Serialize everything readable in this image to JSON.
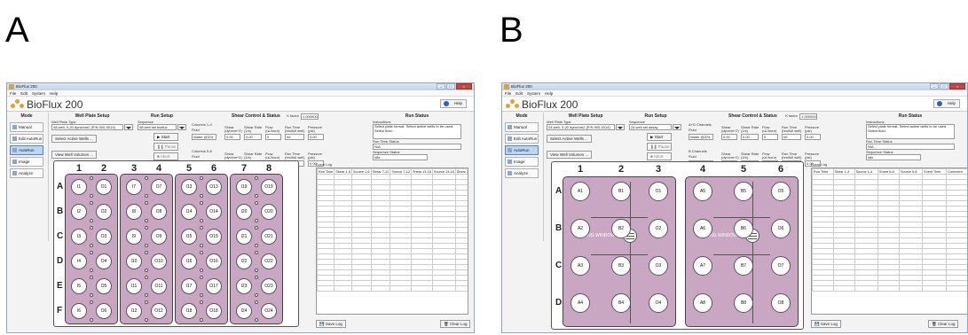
{
  "panels": [
    {
      "letter": "A",
      "window_title": "BioFlux 200",
      "menu": [
        "File",
        "Edit",
        "System",
        "Help"
      ],
      "app_name": "BioFlux 200",
      "help_label": "Help",
      "mode": {
        "heading": "Mode",
        "buttons": [
          "Manual",
          "Edit AutoRun",
          "AutoRun",
          "Image",
          "Analyze"
        ],
        "active": "AutoRun"
      },
      "well_plate_setup": {
        "heading": "Well Plate Setup",
        "type_label": "Well Plate Type",
        "type_value": "48-well, 0-20 dyne/cm2 (P/N 900-0013)",
        "select_active_wells": "Select Active Wells ...",
        "view_well_volumes": "View Well Volumes ..."
      },
      "run_setup": {
        "heading": "Run Setup",
        "sequence_label": "Sequence",
        "sequence_value": "48 well std bioflux",
        "start": "Start",
        "pause": "Pause",
        "abort": "Abort"
      },
      "shear": {
        "heading": "Shear Control & Status",
        "k_factor_label": "K factor",
        "k_factor_value": "1.000000",
        "groups": [
          {
            "name": "Columns 1-4",
            "fluid_label": "Fluid",
            "fluid": "Water @37d",
            "shear_label": "Shear (dyn/cm^2)",
            "shear": "0.00",
            "rate_label": "Shear Rate (1/s)",
            "rate": "0.00",
            "flow_label": "Flow (uL/hour)",
            "flow": "0",
            "runtime_label": "Run Time (hrs/full well)",
            "runtime": "Inf",
            "pressure_label": "Pressure (psi)",
            "pressure": "0.00"
          },
          {
            "name": "Columns 5-8",
            "fluid_label": "Fluid",
            "fluid": "Water @37d",
            "shear_label": "Shear (dyn/cm^2)",
            "shear": "0.00",
            "rate_label": "Shear Rate (1/s)",
            "rate": "0.00",
            "flow_label": "Flow (uL/hour)",
            "flow": "0",
            "runtime_label": "Run Time (hrs/full well)",
            "runtime": "Inf",
            "pressure_label": "Pressure (psi)",
            "pressure": "0.00"
          }
        ]
      },
      "run_status": {
        "heading": "Run Status",
        "instructions_label": "Instructions",
        "instructions": "Select plate format. Select active wells to be used. Select fluid.",
        "run_time_status_label": "Run Time Status",
        "run_time_status": "N/A",
        "sequence_status_label": "Sequence Status",
        "sequence_status": "Idle"
      },
      "plate": {
        "columns": [
          "1",
          "2",
          "3",
          "4",
          "5",
          "6",
          "7",
          "8"
        ],
        "rows": [
          "A",
          "B",
          "C",
          "D",
          "E",
          "F"
        ],
        "wells": [
          [
            "I1",
            "O1",
            "I7",
            "O7",
            "I13",
            "O13",
            "I19",
            "O19"
          ],
          [
            "I2",
            "O2",
            "I8",
            "O8",
            "I14",
            "O14",
            "I20",
            "O20"
          ],
          [
            "I3",
            "O3",
            "I9",
            "O9",
            "I15",
            "O15",
            "I21",
            "O21"
          ],
          [
            "I4",
            "O4",
            "I10",
            "O10",
            "I16",
            "O16",
            "I22",
            "O22"
          ],
          [
            "I5",
            "O5",
            "I11",
            "O11",
            "I17",
            "O17",
            "I23",
            "O23"
          ],
          [
            "I6",
            "O6",
            "I12",
            "O12",
            "I18",
            "O18",
            "I24",
            "O24"
          ]
        ]
      },
      "event_log": {
        "label": "Event Log",
        "columns": [
          "Run Time",
          "Shear 1-6",
          "Source 1-6",
          "Shear 7-12",
          "Source 7-12",
          "Shear 13-18",
          "Source 13-18",
          "Shear 19-24",
          "Sou 19-2"
        ],
        "save": "Save Log",
        "clear": "Clear Log"
      }
    },
    {
      "letter": "B",
      "window_title": "BioFlux 200",
      "menu": [
        "File",
        "Edit",
        "System",
        "Help"
      ],
      "app_name": "BioFlux 200",
      "help_label": "Help",
      "mode": {
        "heading": "Mode",
        "buttons": [
          "Manual",
          "Edit AutoRun",
          "AutoRun",
          "Image",
          "Analyze"
        ],
        "active": "AutoRun"
      },
      "well_plate_setup": {
        "heading": "Well Plate Setup",
        "type_label": "Well Plate Type",
        "type_value": "24-well, 0-20 dyne/cm2 (P/N 900-0014)",
        "select_active_wells": "Select Active Wells ...",
        "view_well_volumes": "View Well Volumes ..."
      },
      "run_setup": {
        "heading": "Run Setup",
        "sequence_label": "Sequence",
        "sequence_value": "24 well std assay",
        "start": "Start",
        "pause": "Pause",
        "abort": "Abort"
      },
      "shear": {
        "heading": "Shear Control & Status",
        "k_factor_label": "K factor",
        "k_factor_value": "1.000000",
        "groups": [
          {
            "name": "A+D Channels",
            "fluid_label": "Fluid",
            "fluid": "Water @37d",
            "shear_label": "Shear (dyn/cm^2)",
            "shear": "0.00",
            "rate_label": "Shear Rate (1/s)",
            "rate": "0.00",
            "flow_label": "Flow (uL/hour)",
            "flow": "0",
            "runtime_label": "Run Time (hrs/full well)",
            "runtime": "Inf",
            "pressure_label": "Pressure (psi)",
            "pressure": "0.00"
          },
          {
            "name": "B Channels",
            "fluid_label": "Fluid",
            "fluid": "Water @37d",
            "shear_label": "Shear (dyn/cm^2)",
            "shear": "0.00",
            "rate_label": "Shear Rate (1/s)",
            "rate": "0.00",
            "flow_label": "Flow (uL/hour)",
            "flow": "0",
            "runtime_label": "Run Time (hrs/full well)",
            "runtime": "Inf",
            "pressure_label": "Pressure (psi)",
            "pressure": "0.00"
          }
        ]
      },
      "run_status": {
        "heading": "Run Status",
        "instructions_label": "Instructions",
        "instructions": "Select plate format. Select active wells to be used. Select fluid.",
        "run_time_status_label": "Run Time Status",
        "run_time_status": "N/A",
        "sequence_status_label": "Sequence Status",
        "sequence_status": "Idle"
      },
      "plate": {
        "columns": [
          "1",
          "2",
          "3",
          "4",
          "5",
          "6"
        ],
        "rows": [
          "A",
          "B",
          "C",
          "D"
        ],
        "wells": [
          [
            "A1",
            "B1",
            "O1",
            "A5",
            "B5",
            "O5"
          ],
          [
            "A2",
            "B2",
            "O2",
            "A6",
            "B6",
            "O6"
          ],
          [
            "A3",
            "B3",
            "O3",
            "A7",
            "B7",
            "O7"
          ],
          [
            "A4",
            "B4",
            "O4",
            "A8",
            "B8",
            "O8"
          ]
        ],
        "viewing_window": "VIEWING WINDOW"
      },
      "event_log": {
        "label": "Event Log",
        "columns": [
          "Run Time",
          "Shear 1-4",
          "Source 1-4",
          "Shear 5-8",
          "Source 5-8",
          "Event Time",
          "Comment"
        ],
        "save": "Save Log",
        "clear": "Clear Log"
      }
    }
  ],
  "colors": {
    "plate_fill": "#c9a7c3",
    "active_mode": "#bcd6f3",
    "title_gradient": "#c3d4ea"
  }
}
